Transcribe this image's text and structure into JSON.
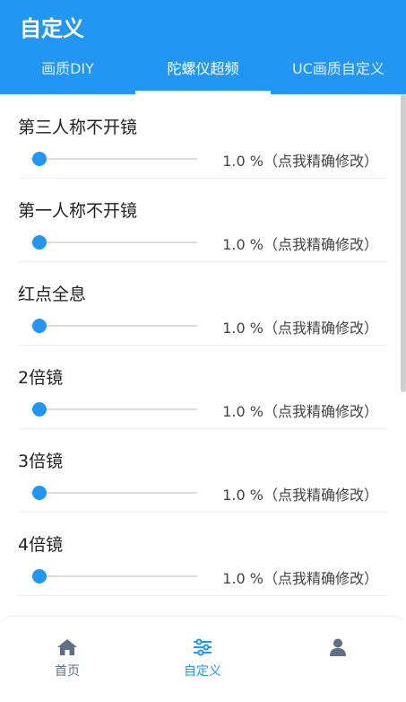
{
  "app": {
    "title": "自定义"
  },
  "tabs": [
    {
      "label": "画质DIY"
    },
    {
      "label": "陀螺仪超频",
      "active": true
    },
    {
      "label": "UC画质自定义"
    }
  ],
  "settings": [
    {
      "label": "第三人称不开镜",
      "value": 1.0,
      "value_text": "1.0 %（点我精确修改）"
    },
    {
      "label": "第一人称不开镜",
      "value": 1.0,
      "value_text": "1.0 %（点我精确修改）"
    },
    {
      "label": "红点全息",
      "value": 1.0,
      "value_text": "1.0 %（点我精确修改）"
    },
    {
      "label": "2倍镜",
      "value": 1.0,
      "value_text": "1.0 %（点我精确修改）"
    },
    {
      "label": "3倍镜",
      "value": 1.0,
      "value_text": "1.0 %（点我精确修改）"
    },
    {
      "label": "4倍镜",
      "value": 1.0,
      "value_text": "1.0 %（点我精确修改）"
    }
  ],
  "bottom_nav": [
    {
      "label": "首页",
      "icon": "home-icon"
    },
    {
      "label": "自定义",
      "icon": "sliders-icon",
      "active": true
    },
    {
      "label": "",
      "icon": "user-icon"
    }
  ],
  "colors": {
    "primary": "#2196f3",
    "nav_inactive": "#5f6f85"
  }
}
